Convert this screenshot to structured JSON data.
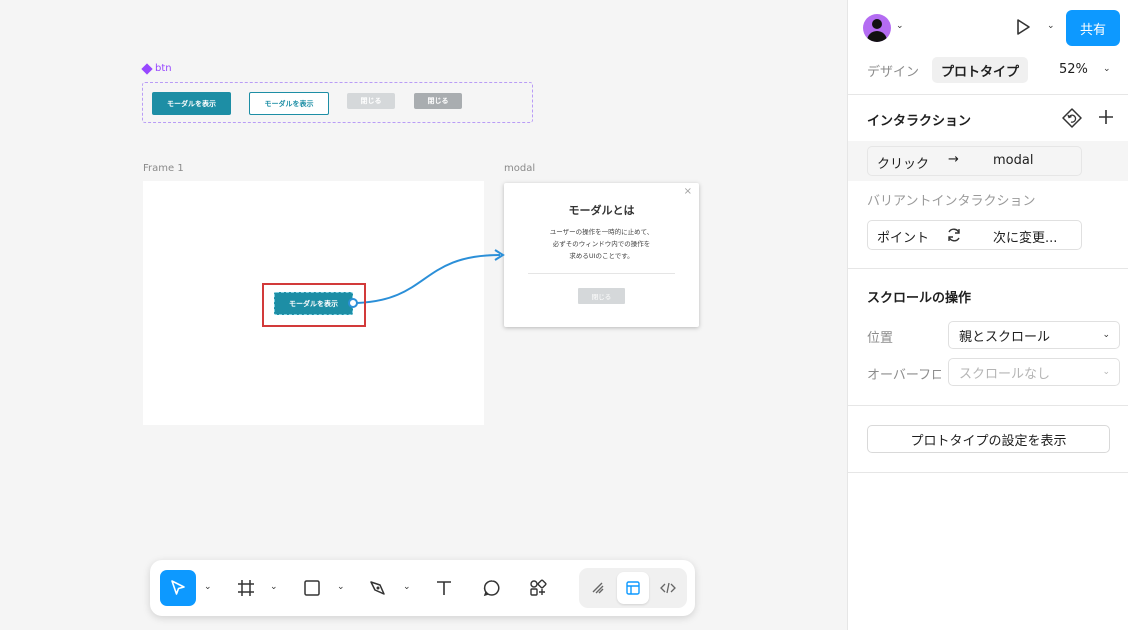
{
  "canvas": {
    "component_label": "btn",
    "variants": [
      "モーダルを表示",
      "モーダルを表示",
      "閉じる",
      "閉じる"
    ],
    "frame1_label": "Frame 1",
    "modal_label": "modal",
    "frame_button": "モーダルを表示",
    "modal": {
      "close_glyph": "×",
      "title": "モーダルとは",
      "line1": "ユーザーの操作を一時的に止めて、",
      "line2": "必ずそのウィンドウ内での操作を",
      "line3": "求めるUIのことです。",
      "close_button": "閉じる"
    }
  },
  "toolbar": {
    "tools": [
      "move-tool",
      "frame-tool",
      "rectangle-tool",
      "pen-tool",
      "text-tool",
      "comment-tool",
      "actions-tool"
    ],
    "modes": [
      "draw-mode",
      "design-mode",
      "dev-mode"
    ],
    "active_tool": "move-tool",
    "active_mode": "design-mode"
  },
  "panel": {
    "share_label": "共有",
    "tabs": [
      "デザイン",
      "プロトタイプ"
    ],
    "active_tab": "プロトタイプ",
    "zoom": "52%",
    "interactions": {
      "title": "インタラクション",
      "trigger": "クリック",
      "arrow": "→",
      "destination": "modal"
    },
    "variant_interactions": {
      "title": "バリアントインタラクション",
      "trigger": "ポイント",
      "action": "次に変更..."
    },
    "scroll": {
      "title": "スクロールの操作",
      "position_label": "位置",
      "position_value": "親とスクロール",
      "overflow_label": "オーバーフロー",
      "overflow_value": "スクロールなし"
    },
    "settings_button": "プロトタイプの設定を表示"
  },
  "colors": {
    "accent": "#0d99ff",
    "component": "#9747ff",
    "button_teal": "#1d8ea5",
    "selection_red": "#d23a3a"
  }
}
